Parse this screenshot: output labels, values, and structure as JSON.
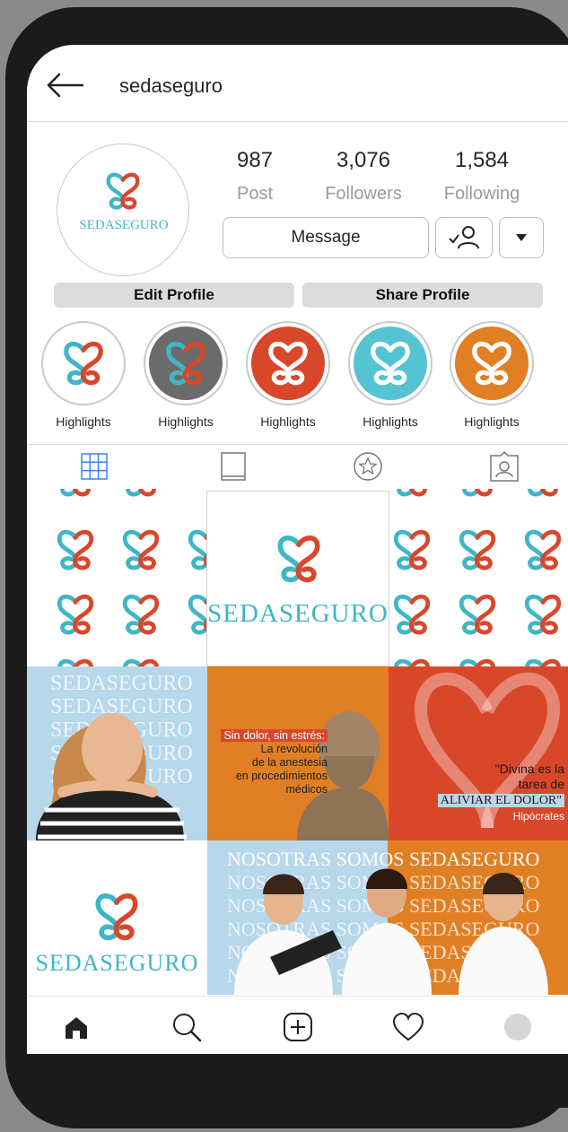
{
  "header": {
    "username": "sedaseguro"
  },
  "profile": {
    "avatar_brand": "SEDASEGURO",
    "stats": [
      {
        "value": "987",
        "label": "Post"
      },
      {
        "value": "3,076",
        "label": "Followers"
      },
      {
        "value": "1,584",
        "label": "Following"
      }
    ],
    "message_label": "Message",
    "edit_label": "Edit Profile",
    "share_label": "Share Profile"
  },
  "highlights": [
    {
      "label": "Highlights",
      "bg": "#ffffff"
    },
    {
      "label": "Highlights",
      "bg": "#6b6b6b"
    },
    {
      "label": "Highlights",
      "bg": "#d9472b"
    },
    {
      "label": "Highlights",
      "bg": "#55c3d2"
    },
    {
      "label": "Highlights",
      "bg": "#e07f24"
    }
  ],
  "tabs": [
    "grid-icon",
    "reels-icon",
    "saved-icon",
    "tagged-icon"
  ],
  "posts": {
    "center_brand": "SEDASEGURO",
    "bg_brand": "SEDASEGURO",
    "anesthesia": {
      "headline": "Sin dolor, sin estrés:",
      "line1": "La revolución",
      "line2": "de la anestesia",
      "line3": "en procedimientos",
      "line4": "médicos"
    },
    "quote": {
      "line1": "\"Divina es la",
      "line2": "tarea de",
      "line3": "ALIVIAR EL DOLOR\"",
      "author": "Hipócrates"
    },
    "brand_tile": "SEDASEGURO",
    "nosotras_line1": "NOSOTRAS SOMOS SEDASEGURO",
    "nosotras_bg": "NOSOTRAS SOMOS SEDASEGURO"
  },
  "nav": [
    "home-icon",
    "search-icon",
    "add-icon",
    "heart-icon",
    "profile-icon"
  ],
  "colors": {
    "teal": "#3fb6c6",
    "red": "#d9472b",
    "orange": "#e07f24",
    "blue": "#b7d7ea"
  }
}
